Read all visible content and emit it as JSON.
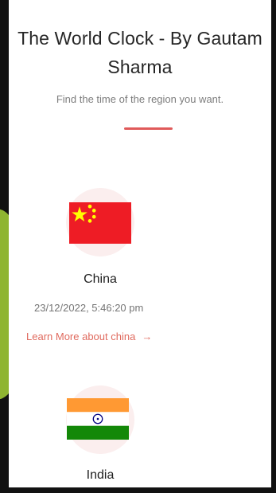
{
  "header": {
    "title_line1": "The World Clock - By Gautam",
    "title_line2": "Sharma",
    "subtitle": "Find the time of the region you want."
  },
  "countries": [
    {
      "name": "China",
      "time": "23/12/2022, 5:46:20 pm",
      "link_text": "Learn More about china",
      "flag_icon": "china-flag-icon"
    },
    {
      "name": "India",
      "flag_icon": "india-flag-icon"
    }
  ],
  "colors": {
    "accent": "#e05a5a",
    "link": "#e06a5e",
    "china_red": "#ee1c25",
    "china_star": "#ffff00",
    "india_saffron": "#ff9933",
    "india_green": "#138808",
    "chakra_blue": "#000080"
  }
}
